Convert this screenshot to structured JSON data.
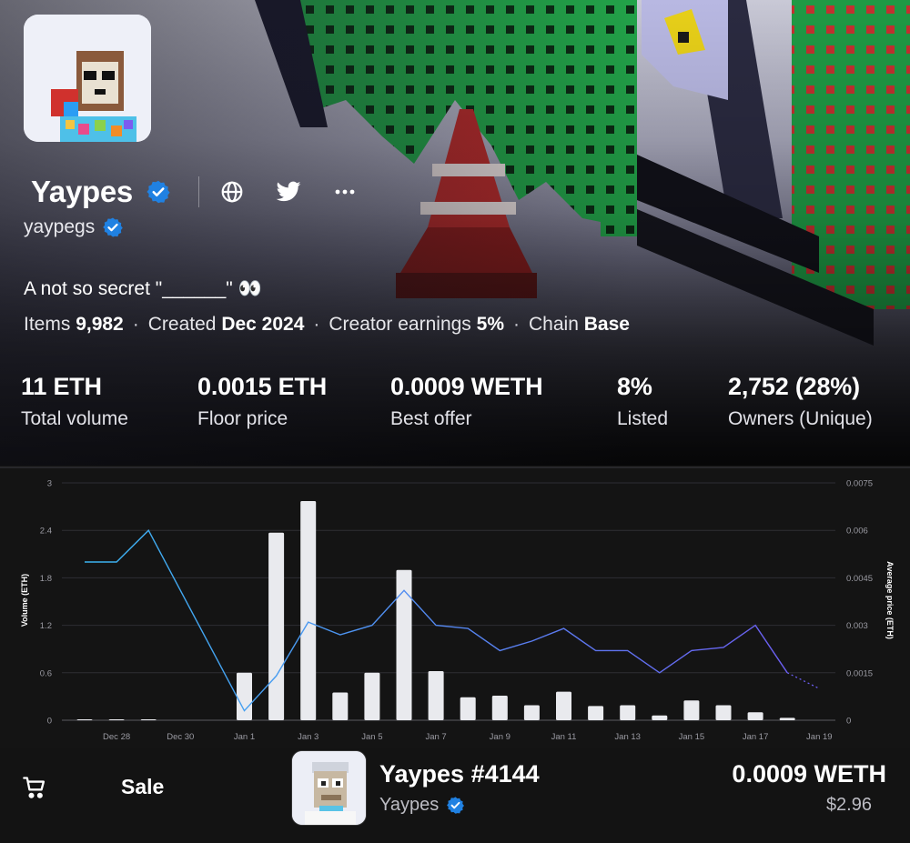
{
  "collection": {
    "name": "Yaypes",
    "creator": "yaypegs",
    "description": "A not so secret \"______\" 👀",
    "meta": {
      "items_label": "Items",
      "items_value": "9,982",
      "created_label": "Created",
      "created_value": "Dec 2024",
      "earnings_label": "Creator earnings",
      "earnings_value": "5%",
      "chain_label": "Chain",
      "chain_value": "Base",
      "separator": "·"
    },
    "icons": [
      "verified-badge-icon",
      "globe-icon",
      "twitter-icon",
      "more-icon"
    ]
  },
  "stats": [
    {
      "value": "11 ETH",
      "label": "Total volume"
    },
    {
      "value": "0.0015 ETH",
      "label": "Floor price"
    },
    {
      "value": "0.0009 WETH",
      "label": "Best offer"
    },
    {
      "value": "8%",
      "label": "Listed"
    },
    {
      "value": "2,752 (28%)",
      "label": "Owners (Unique)"
    }
  ],
  "chart_data": {
    "type": "bar",
    "ylabel": "Volume (ETH)",
    "y2label": "Average price (ETH)",
    "ylim": [
      0,
      3
    ],
    "y2lim": [
      0,
      0.0075
    ],
    "yticks": [
      "0",
      "0.6",
      "1.2",
      "1.8",
      "2.4",
      "3"
    ],
    "y2ticks": [
      "0",
      "0.0015",
      "0.003",
      "0.0045",
      "0.006",
      "0.0075"
    ],
    "xticks": [
      "Dec 28",
      "Dec 30",
      "Jan 1",
      "Jan 3",
      "Jan 5",
      "Jan 7",
      "Jan 9",
      "Jan 11",
      "Jan 13",
      "Jan 15",
      "Jan 17",
      "Jan 19"
    ],
    "grid": true,
    "series": [
      {
        "type": "bar",
        "axis": "left",
        "x": [
          0,
          1,
          2,
          5,
          6,
          7,
          8,
          9,
          10,
          11,
          12,
          13,
          14,
          15,
          16,
          17,
          18,
          19,
          20,
          21,
          22
        ],
        "values": [
          0.01,
          0.01,
          0.01,
          0.6,
          2.37,
          2.77,
          0.35,
          0.6,
          1.9,
          0.62,
          0.29,
          0.31,
          0.19,
          0.36,
          0.18,
          0.19,
          0.06,
          0.25,
          0.19,
          0.1,
          0.03
        ],
        "color": "#e9eaee"
      },
      {
        "type": "line",
        "axis": "right",
        "x": [
          0,
          1,
          2,
          5,
          6,
          7,
          8,
          9,
          10,
          11,
          12,
          13,
          14,
          15,
          16,
          17,
          18,
          19,
          20,
          21,
          22
        ],
        "values": [
          0.005,
          0.005,
          0.006,
          0.0003,
          0.0014,
          0.0031,
          0.0027,
          0.003,
          0.0041,
          0.003,
          0.0029,
          0.0022,
          0.0025,
          0.0029,
          0.0022,
          0.0022,
          0.0015,
          0.0022,
          0.0023,
          0.003,
          0.0015
        ],
        "projection": [
          0.0015,
          0.001
        ],
        "color_start": "#3bb3f0",
        "color_end": "#6b5ef0"
      }
    ]
  },
  "sale": {
    "label": "Sale",
    "item_name": "Yaypes #4144",
    "item_collection": "Yaypes",
    "price": "0.0009 WETH",
    "usd": "$2.96"
  }
}
